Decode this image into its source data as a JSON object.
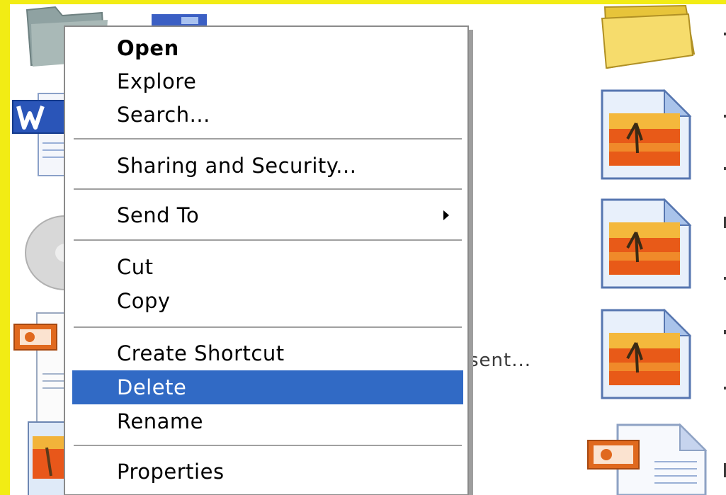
{
  "context_menu": {
    "items": [
      {
        "label": "Open",
        "default": true
      },
      {
        "label": "Explore"
      },
      {
        "label": "Search..."
      },
      {
        "label": "Sharing and Security..."
      },
      {
        "label": "Send To",
        "submenu": true
      },
      {
        "label": "Cut"
      },
      {
        "label": "Copy"
      },
      {
        "label": "Create Shortcut"
      },
      {
        "label": "Delete",
        "highlighted": true
      },
      {
        "label": "Rename"
      },
      {
        "label": "Properties"
      }
    ]
  },
  "background": {
    "partial_label": "sent..."
  },
  "colors": {
    "selection": "#316ac5",
    "frame": "#ffff00"
  },
  "icons": [
    "folder-icon-gray",
    "word-document-icon",
    "cd-disc-icon",
    "powerpoint-document-icon",
    "picture-document-icon",
    "folder-icon",
    "image-file-icon",
    "powerpoint-file-icon"
  ]
}
